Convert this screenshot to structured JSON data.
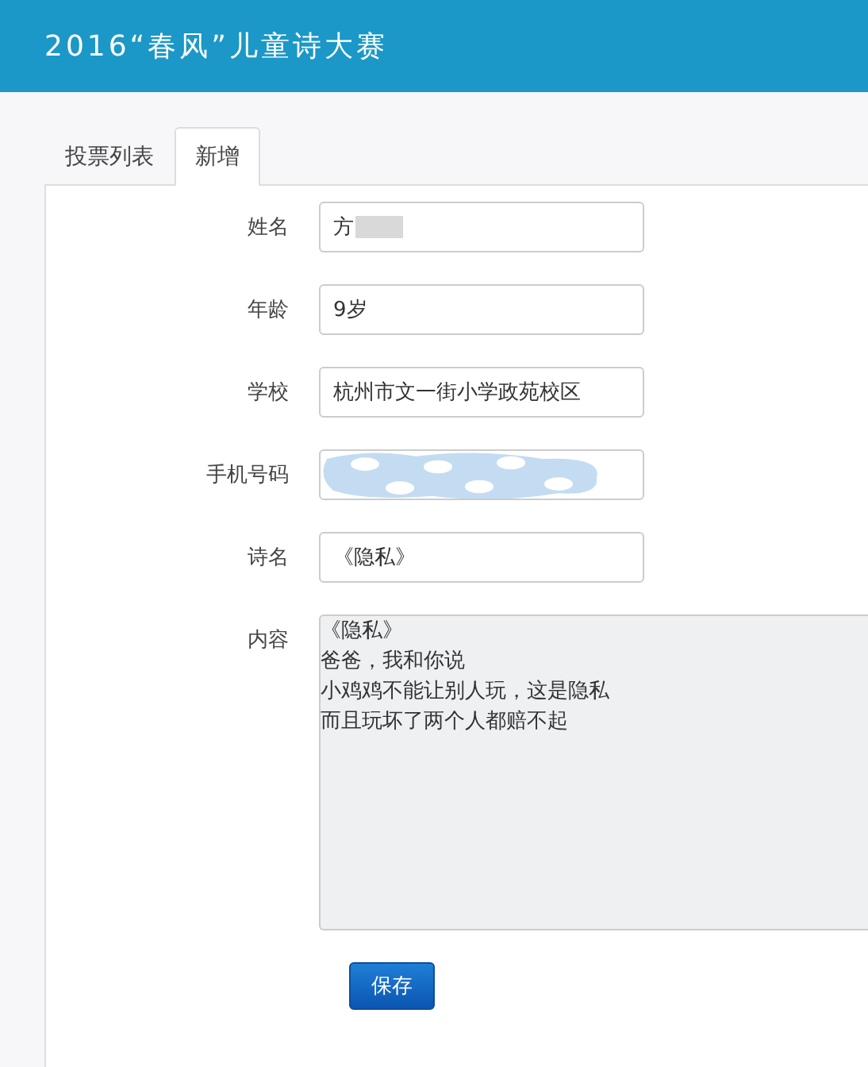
{
  "header": {
    "title": "2016“春风”儿童诗大赛"
  },
  "tabs": [
    {
      "label": "投票列表",
      "selected": false
    },
    {
      "label": "新增",
      "selected": true
    }
  ],
  "form": {
    "fields": [
      {
        "label": "姓名",
        "value": "方",
        "redacted": true,
        "kind": "text"
      },
      {
        "label": "年龄",
        "value": "9岁",
        "kind": "text"
      },
      {
        "label": "学校",
        "value": "杭州市文一街小学政苑校区",
        "kind": "text"
      },
      {
        "label": "手机号码",
        "kind": "covered"
      },
      {
        "label": "诗名",
        "value": "《隐私》",
        "kind": "text"
      },
      {
        "label": "内容",
        "lines": [
          "《隐私》",
          "爸爸，我和你说",
          "小鸡鸡不能让别人玩，这是隐私",
          "而且玩坏了两个人都赔不起"
        ],
        "kind": "textarea"
      }
    ],
    "save_button": "保存"
  }
}
